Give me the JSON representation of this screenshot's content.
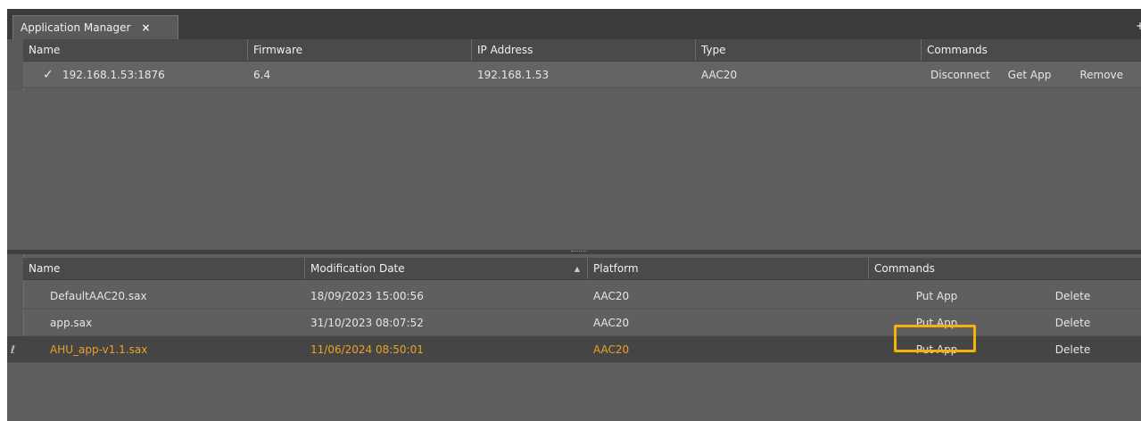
{
  "tab": {
    "title": "Application Manager",
    "close": "×"
  },
  "plus": "+",
  "devices": {
    "columns": [
      "Name",
      "Firmware",
      "IP Address",
      "Type",
      "Commands"
    ],
    "rows": [
      {
        "name": "192.168.1.53:1876",
        "firmware": "6.4",
        "ip": "192.168.1.53",
        "type": "AAC20",
        "commands": [
          "Disconnect",
          "Get App",
          "Remove"
        ],
        "checked": true
      }
    ]
  },
  "apps": {
    "columns": [
      "Name",
      "Modification Date",
      "Platform",
      "Commands"
    ],
    "sort_icon": "▲",
    "rows": [
      {
        "name": "DefaultAAC20.sax",
        "date": "18/09/2023 15:00:56",
        "platform": "AAC20",
        "put": "Put App",
        "delete": "Delete"
      },
      {
        "name": "app.sax",
        "date": "31/10/2023 08:07:52",
        "platform": "AAC20",
        "put": "Put App",
        "delete": "Delete"
      },
      {
        "name": "AHU_app-v1.1.sax",
        "date": "11/06/2024 08:50:01",
        "platform": "AAC20",
        "put": "Put App",
        "delete": "Delete",
        "selected": true
      }
    ]
  },
  "colors": {
    "accent": "#e9a226",
    "highlight": "#f5b20a"
  }
}
